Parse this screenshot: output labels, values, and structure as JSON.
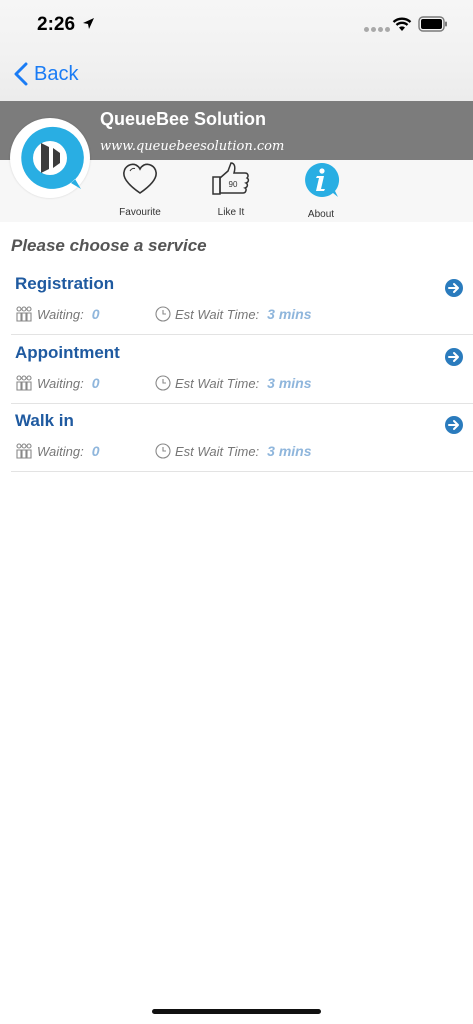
{
  "status_bar": {
    "time": "2:26"
  },
  "nav": {
    "back_label": "Back"
  },
  "header": {
    "org_name": "QueueBee Solution",
    "org_url": "www.queuebeesolution.com"
  },
  "actions": [
    {
      "label": "Favourite",
      "icon": "heart-icon"
    },
    {
      "label": "Like It",
      "icon": "thumbs-up-icon",
      "count": "90"
    },
    {
      "label": "About",
      "icon": "info-icon"
    }
  ],
  "section_title": "Please choose a service",
  "services": [
    {
      "name": "Registration",
      "waiting_label": "Waiting:",
      "waiting_value": "0",
      "est_label": "Est Wait Time:",
      "est_value": "3 mins"
    },
    {
      "name": "Appointment",
      "waiting_label": "Waiting:",
      "waiting_value": "0",
      "est_label": "Est Wait Time:",
      "est_value": "3 mins"
    },
    {
      "name": "Walk in",
      "waiting_label": "Waiting:",
      "waiting_value": "0",
      "est_label": "Est Wait Time:",
      "est_value": "3 mins"
    }
  ],
  "colors": {
    "accent": "#1a7cf5",
    "service_name": "#1f5aa0",
    "header_band": "#7c7c7c",
    "info_icon": "#29aee3",
    "go_icon": "#2a7bbd",
    "meta_value": "#8fb6dc"
  }
}
